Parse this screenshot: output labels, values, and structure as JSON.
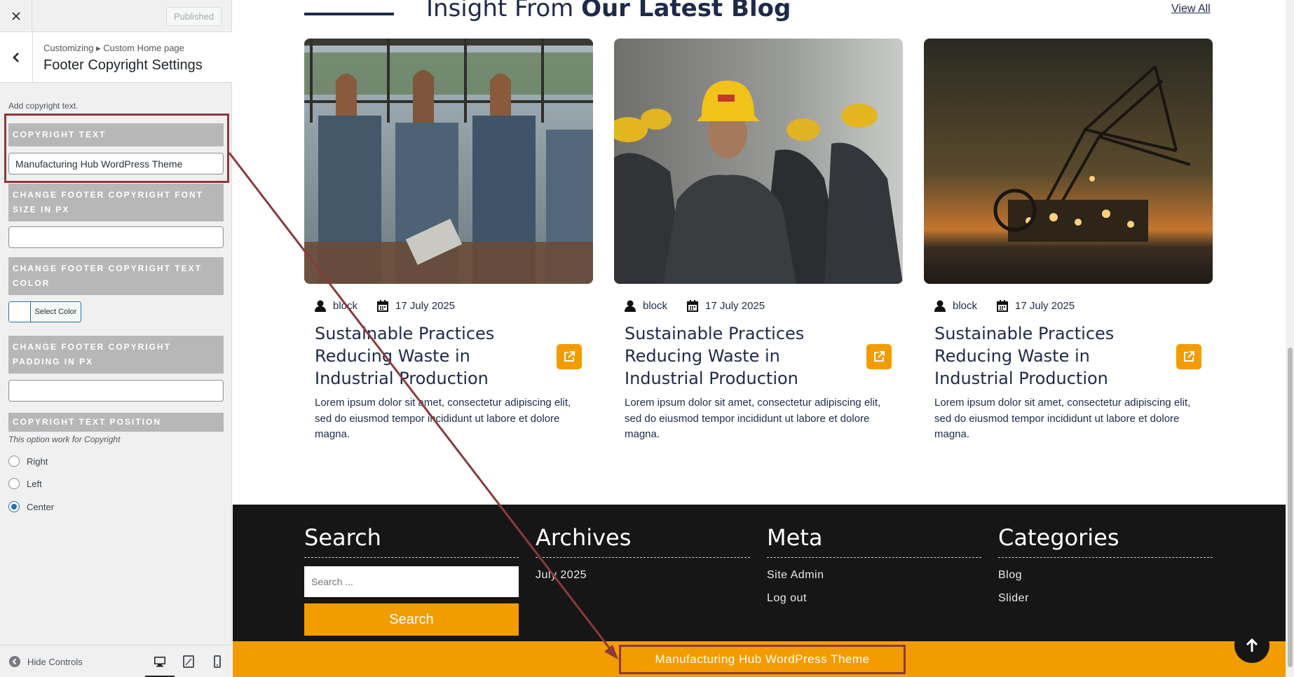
{
  "sidebar": {
    "publish_label": "Published",
    "breadcrumb": "Customizing ▸ Custom Home page",
    "section_title": "Footer Copyright Settings",
    "description": "Add copyright text.",
    "copyright_header": "COPYRIGHT TEXT",
    "copyright_value": "Manufacturing Hub WordPress Theme",
    "font_size_header": "CHANGE FOOTER COPYRIGHT FONT SIZE IN PX",
    "font_size_value": "",
    "text_color_header": "CHANGE FOOTER COPYRIGHT TEXT COLOR",
    "select_color_label": "Select Color",
    "padding_header": "CHANGE FOOTER COPYRIGHT PADDING IN PX",
    "padding_value": "",
    "position_header": "COPYRIGHT TEXT POSITION",
    "position_note": "This option work for Copyright",
    "position_options": [
      "Right",
      "Left",
      "Center"
    ],
    "position_selected": "Center",
    "hide_controls_label": "Hide Controls",
    "icons": [
      "close-icon",
      "back-arrow-icon",
      "hide-controls-icon",
      "desktop-icon",
      "tablet-icon",
      "mobile-icon"
    ]
  },
  "blog": {
    "heading_light": "Insight From ",
    "heading_bold": "Our Latest Blog",
    "view_all": "View All",
    "posts": [
      {
        "author": "block",
        "date": "17 July 2025",
        "title": "Sustainable Practices Reducing Waste in Industrial Production",
        "excerpt": "Lorem ipsum dolor sit amet, consectetur adipiscing elit, sed do eiusmod tempor incididunt ut labore et dolore magna.",
        "image": "industrial-pipes-tanks"
      },
      {
        "author": "block",
        "date": "17 July 2025",
        "title": "Sustainable Practices Reducing Waste in Industrial Production",
        "excerpt": "Lorem ipsum dolor sit amet, consectetur adipiscing elit, sed do eiusmod tempor incididunt ut labore et dolore magna.",
        "image": "workers-hard-hats"
      },
      {
        "author": "block",
        "date": "17 July 2025",
        "title": "Sustainable Practices Reducing Waste in Industrial Production",
        "excerpt": "Lorem ipsum dolor sit amet, consectetur adipiscing elit, sed do eiusmod tempor incididunt ut labore et dolore magna.",
        "image": "mining-excavator-sunset"
      }
    ]
  },
  "footer": {
    "search": {
      "heading": "Search",
      "placeholder": "Search ...",
      "button": "Search"
    },
    "archives": {
      "heading": "Archives",
      "items": [
        "July 2025"
      ]
    },
    "meta": {
      "heading": "Meta",
      "items": [
        "Site Admin",
        "Log out"
      ]
    },
    "categories": {
      "heading": "Categories",
      "items": [
        "Blog",
        "Slider"
      ]
    },
    "copyright": "Manufacturing Hub WordPress Theme"
  },
  "colors": {
    "accent": "#f39c00",
    "navy": "#1e2a4a",
    "footer_bg": "#161616",
    "annotation": "#8b3a3a",
    "wp_blue": "#2271b1"
  }
}
